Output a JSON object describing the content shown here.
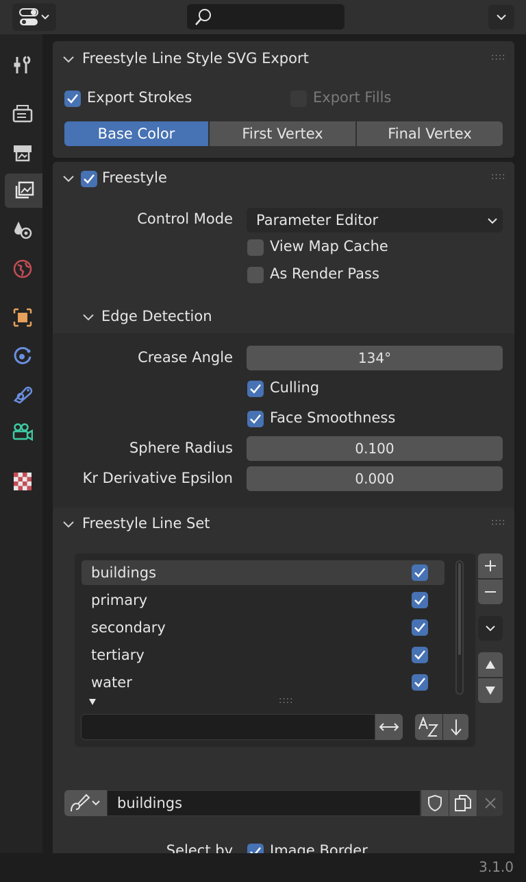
{
  "header": {
    "search_value": "",
    "editor_type_icon": "editor-type-icon",
    "dropdown_icon": "chevron-down-icon"
  },
  "sidebar": {
    "tabs": [
      {
        "name": "tool",
        "icon": "tool-icon",
        "active": false
      },
      {
        "name": "render",
        "icon": "render-icon",
        "active": false
      },
      {
        "name": "output",
        "icon": "output-icon",
        "active": false
      },
      {
        "name": "view-layer",
        "icon": "view-layer-icon",
        "active": true
      },
      {
        "name": "scene",
        "icon": "scene-icon",
        "active": false
      },
      {
        "name": "world",
        "icon": "world-icon",
        "active": false
      },
      {
        "name": "object",
        "icon": "object-icon",
        "active": false
      },
      {
        "name": "physics",
        "icon": "physics-icon",
        "active": false
      },
      {
        "name": "constraints",
        "icon": "constraints-icon",
        "active": false
      },
      {
        "name": "camera-data",
        "icon": "camera-icon",
        "active": false
      },
      {
        "name": "texture",
        "icon": "texture-icon",
        "active": false
      }
    ]
  },
  "svg_export": {
    "title": "Freestyle Line Style SVG Export",
    "export_strokes": {
      "label": "Export Strokes",
      "checked": true
    },
    "export_fills": {
      "label": "Export Fills",
      "checked": false
    },
    "modes": [
      {
        "label": "Base Color",
        "active": true
      },
      {
        "label": "First Vertex",
        "active": false
      },
      {
        "label": "Final Vertex",
        "active": false
      }
    ]
  },
  "freestyle": {
    "title": "Freestyle",
    "enabled": true,
    "control_mode_label": "Control Mode",
    "control_mode_value": "Parameter Editor",
    "view_map_cache": {
      "label": "View Map Cache",
      "checked": false
    },
    "as_render_pass": {
      "label": "As Render Pass",
      "checked": false
    },
    "edge_detection": {
      "title": "Edge Detection",
      "crease_angle_label": "Crease Angle",
      "crease_angle_value": "134°",
      "culling": {
        "label": "Culling",
        "checked": true
      },
      "face_smoothness": {
        "label": "Face Smoothness",
        "checked": true
      },
      "sphere_radius_label": "Sphere Radius",
      "sphere_radius_value": "0.100",
      "kr_label": "Kr Derivative Epsilon",
      "kr_value": "0.000"
    }
  },
  "line_set": {
    "title": "Freestyle Line Set",
    "items": [
      {
        "label": "buildings",
        "checked": true,
        "selected": true
      },
      {
        "label": "primary",
        "checked": true,
        "selected": false
      },
      {
        "label": "secondary",
        "checked": true,
        "selected": false
      },
      {
        "label": "tertiary",
        "checked": true,
        "selected": false
      },
      {
        "label": "water",
        "checked": true,
        "selected": false
      }
    ],
    "filter_value": "",
    "linestyle_name": "buildings",
    "select_by_label": "Select by",
    "image_border": {
      "label": "Image Border",
      "checked": true
    }
  },
  "footer": {
    "version": "3.1.0"
  },
  "colors": {
    "accent": "#4772b3",
    "panel": "#303030",
    "background": "#1d1d1d",
    "field": "#545454"
  }
}
